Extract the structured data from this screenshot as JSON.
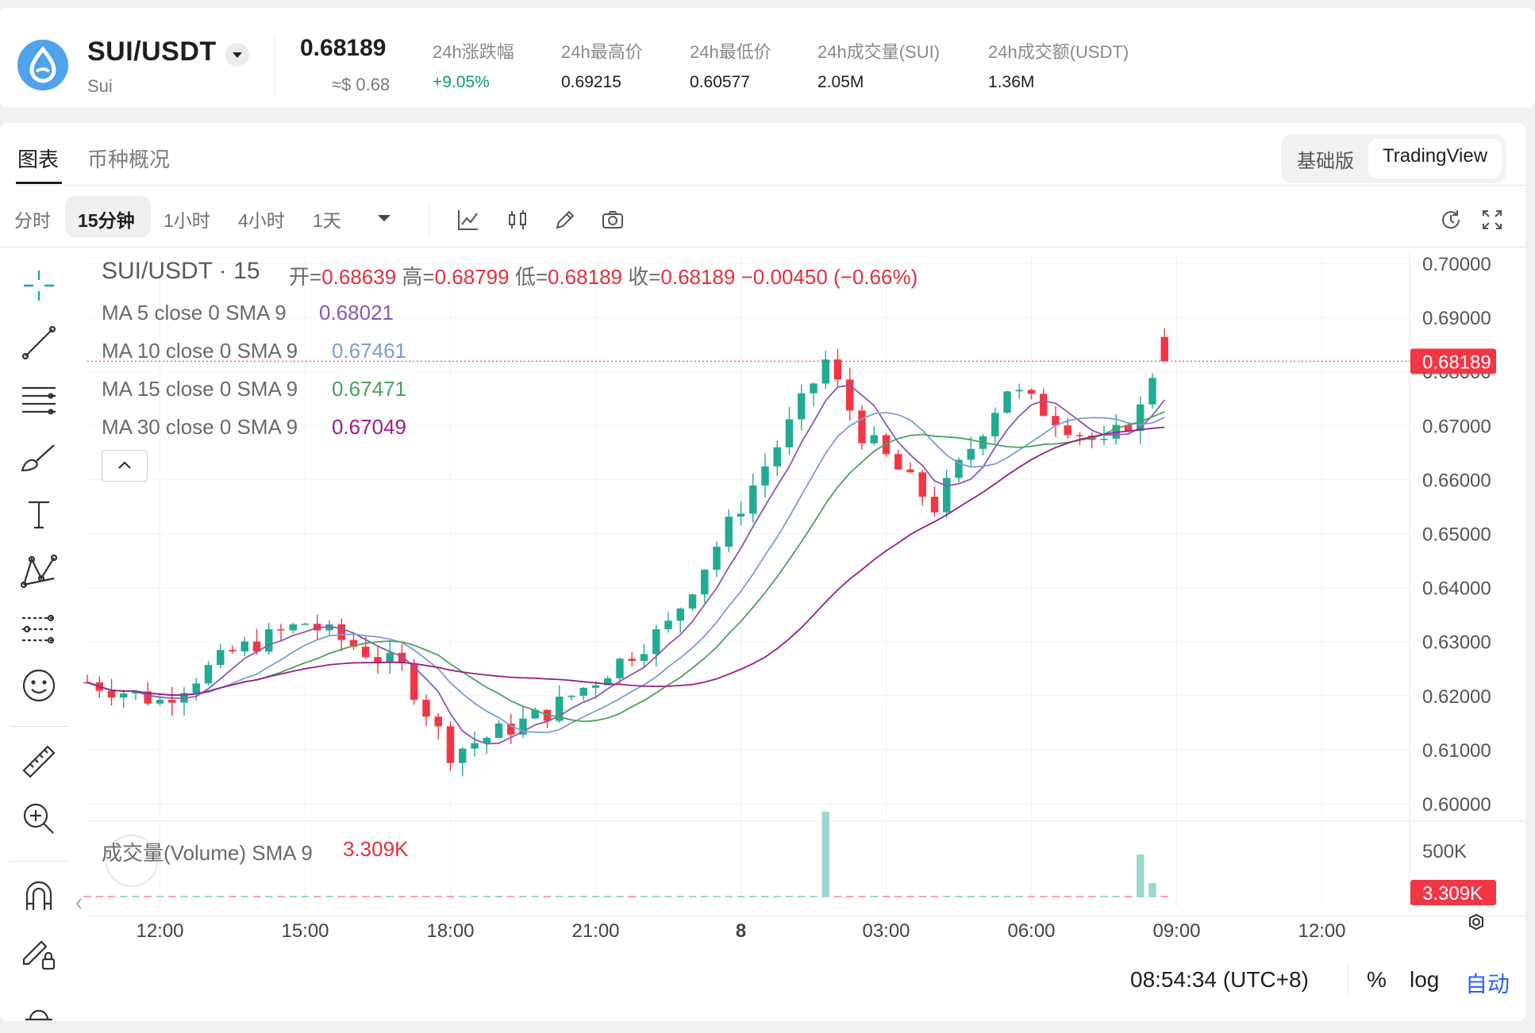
{
  "ticker": {
    "pair": "SUI/USDT",
    "coin_name": "Sui",
    "price": "0.68189",
    "price_usd": "≈$ 0.68",
    "stats": [
      {
        "label": "24h涨跌幅",
        "value": "+9.05%"
      },
      {
        "label": "24h最高价",
        "value": "0.69215"
      },
      {
        "label": "24h最低价",
        "value": "0.60577"
      },
      {
        "label": "24h成交量(SUI)",
        "value": "2.05M"
      },
      {
        "label": "24h成交额(USDT)",
        "value": "1.36M"
      }
    ]
  },
  "tabs": {
    "chart": "图表",
    "overview": "币种概况"
  },
  "view_toggle": {
    "basic": "基础版",
    "tradingview": "TradingView"
  },
  "intervals": [
    "分时",
    "15分钟",
    "1小时",
    "4小时",
    "1天"
  ],
  "legend": {
    "symbol": "SUI/USDT · 15",
    "open_label": "开=",
    "open": "0.68639",
    "high_label": "高=",
    "high": "0.68799",
    "low_label": "低=",
    "low": "0.68189",
    "close_label": "收=",
    "close": "0.68189",
    "change": "−0.00450 (−0.66%)",
    "ma": [
      {
        "label": "MA 5 close 0 SMA 9",
        "value": "0.68021",
        "color": "#8e57b5"
      },
      {
        "label": "MA 10 close 0 SMA 9",
        "value": "0.67461",
        "color": "#7b9fd1"
      },
      {
        "label": "MA 15 close 0 SMA 9",
        "value": "0.67471",
        "color": "#4aa35a"
      },
      {
        "label": "MA 30 close 0 SMA 9",
        "value": "0.67049",
        "color": "#9b1f8a"
      }
    ],
    "volume_label": "成交量(Volume) SMA 9",
    "volume_value": "3.309K"
  },
  "price_axis": {
    "ticks": [
      "0.70000",
      "0.69000",
      "0.68000",
      "0.67000",
      "0.66000",
      "0.65000",
      "0.64000",
      "0.63000",
      "0.62000",
      "0.61000",
      "0.60000"
    ],
    "current_price": "0.68189",
    "volume_tick": "500K",
    "volume_current": "3.309K"
  },
  "time_axis": [
    "12:00",
    "15:00",
    "18:00",
    "21:00",
    "8",
    "03:00",
    "06:00",
    "09:00",
    "12:00"
  ],
  "footer": {
    "clock": "08:54:34 (UTC+8)",
    "percent": "%",
    "log": "log",
    "auto": "自动"
  },
  "colors": {
    "up": "#22ab94",
    "down": "#f23645",
    "accent": "#2962ff"
  },
  "chart_data": {
    "type": "candlestick",
    "symbol": "SUI/USDT",
    "interval": "15",
    "ylim": [
      0.6,
      0.7
    ],
    "x_ticks": [
      "12:00",
      "15:00",
      "18:00",
      "21:00",
      "8",
      "03:00",
      "06:00",
      "09:00",
      "12:00"
    ],
    "key_points": [
      {
        "x": "10:30",
        "y": 0.6225
      },
      {
        "x": "12:00",
        "y": 0.619
      },
      {
        "x": "13:30",
        "y": 0.628
      },
      {
        "x": "15:00",
        "y": 0.6335
      },
      {
        "x": "17:00",
        "y": 0.625
      },
      {
        "x": "18:00",
        "y": 0.6095
      },
      {
        "x": "20:00",
        "y": 0.617
      },
      {
        "x": "21:00",
        "y": 0.623
      },
      {
        "x": "22:30",
        "y": 0.633
      },
      {
        "x": "01:00",
        "y": 0.67
      },
      {
        "x": "01:45",
        "y": 0.682
      },
      {
        "x": "02:30",
        "y": 0.6685
      },
      {
        "x": "04:00",
        "y": 0.655
      },
      {
        "x": "05:30",
        "y": 0.677
      },
      {
        "x": "07:30",
        "y": 0.666
      },
      {
        "x": "08:15",
        "y": 0.673
      },
      {
        "x": "08:45",
        "y": 0.6864
      },
      {
        "x": "08:54",
        "y": 0.68189
      }
    ],
    "volume_peaks": [
      {
        "x": "01:45",
        "value": 900000
      },
      {
        "x": "08:15",
        "value": 450000
      },
      {
        "x": "08:30",
        "value": 150000
      }
    ],
    "ma": [
      {
        "name": "MA 5 close 0 SMA 9",
        "last": 0.68021
      },
      {
        "name": "MA 10 close 0 SMA 9",
        "last": 0.67461
      },
      {
        "name": "MA 15 close 0 SMA 9",
        "last": 0.67471
      },
      {
        "name": "MA 30 close 0 SMA 9",
        "last": 0.67049
      }
    ]
  }
}
